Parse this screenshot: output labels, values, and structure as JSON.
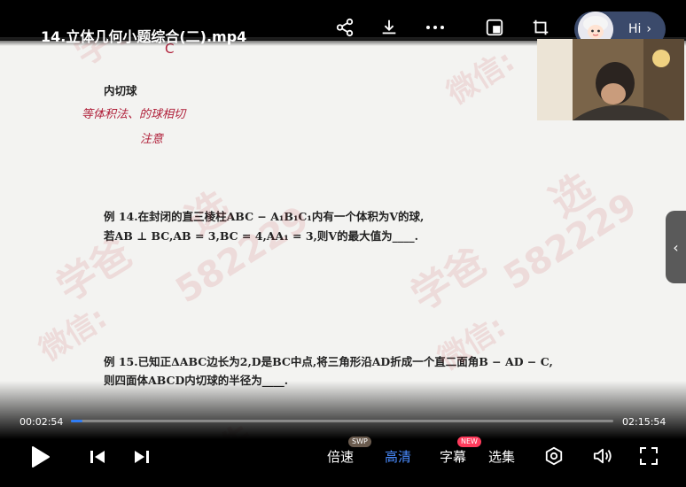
{
  "header": {
    "title": "14.立体几何小题综合(二).mp4",
    "hi_label": "Hi",
    "icons": [
      "share-icon",
      "download-icon",
      "more-icon",
      "pip-icon",
      "screenshot-icon"
    ]
  },
  "document": {
    "section_title": "内切球",
    "margin_mark": "C",
    "handwritten_note_line1": "等体积法、的球相切",
    "handwritten_note_line2": "注意",
    "example14_line1": "例 14.在封闭的直三棱柱ABC − A₁B₁C₁内有一个体积为V的球,",
    "example14_line2": "若AB ⊥ BC,AB = 3,BC = 4,AA₁ = 3,则V的最大值为____.",
    "example15_line1": "例 15.已知正ΔABC边长为2,D是BC中点,将三角形沿AD折成一个直二面角B − AD − C,",
    "example15_line2": "则四面体ABCD内切球的半径为____."
  },
  "watermark": {
    "text_a": "学爸",
    "text_b": "微信:",
    "number": "582229",
    "char": "选"
  },
  "player": {
    "current_time": "00:02:54",
    "total_time": "02:15:54",
    "progress": 0.021,
    "speed_label": "倍速",
    "speed_badge": "SWP",
    "quality_label": "高清",
    "subtitle_label": "字幕",
    "subtitle_badge": "NEW",
    "episodes_label": "选集",
    "accent_color": "#2f7df6",
    "badge_color": "#ff3b5c"
  }
}
